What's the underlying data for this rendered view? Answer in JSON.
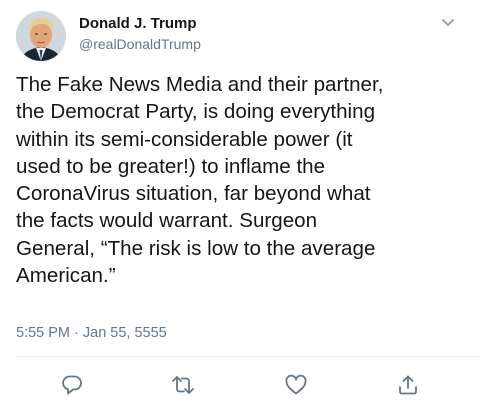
{
  "author": {
    "display_name": "Donald J. Trump",
    "handle": "@realDonaldTrump"
  },
  "tweet": {
    "text_lines": [
      "The Fake News Media and their partner,",
      "the Democrat Party, is doing everything",
      "within its semi-considerable power (it",
      "used to be greater!) to inflame the",
      "CoronaVirus situation, far beyond what",
      "the facts would warrant. Surgeon",
      "General, “The risk is low to the average",
      "American.”"
    ],
    "timestamp": "5:55 PM · Jan 55, 5555"
  },
  "icons": {
    "menu": "chevron-down-icon",
    "reply": "reply-icon",
    "retweet": "retweet-icon",
    "like": "like-icon",
    "share": "share-icon"
  },
  "colors": {
    "text": "#14171a",
    "secondary_text": "#657786",
    "icon": "#657786",
    "divider": "#e6ecf0"
  }
}
